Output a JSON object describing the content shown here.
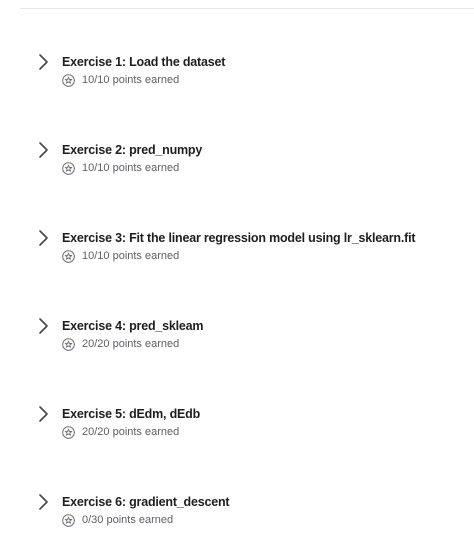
{
  "exercises": [
    {
      "title": "Exercise 1: Load the dataset",
      "points": "10/10 points earned"
    },
    {
      "title": "Exercise 2: pred_numpy",
      "points": "10/10 points earned"
    },
    {
      "title": "Exercise 3: Fit the linear regression model using lr_sklearn.fit",
      "points": "10/10 points earned"
    },
    {
      "title": "Exercise 4: pred_skleam",
      "points": "20/20 points earned"
    },
    {
      "title": "Exercise 5: dEdm, dEdb",
      "points": "20/20 points earned"
    },
    {
      "title": "Exercise 6: gradient_descent",
      "points": "0/30 points earned"
    }
  ]
}
